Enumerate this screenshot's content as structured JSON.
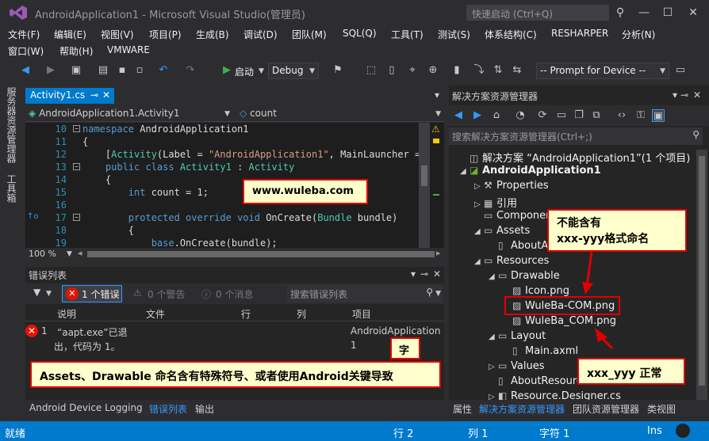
{
  "window": {
    "title": "AndroidApplication1 - Microsoft Visual Studio(管理员)",
    "quick_launch_placeholder": "快速启动 (Ctrl+Q)"
  },
  "menu": {
    "row1": [
      "文件(F)",
      "编辑(E)",
      "视图(V)",
      "项目(P)",
      "生成(B)",
      "调试(D)",
      "团队(M)",
      "SQL(Q)",
      "工具(T)",
      "测试(S)",
      "体系结构(C)",
      "RESHARPER",
      "分析(N)"
    ],
    "row2": [
      "窗口(W)",
      "帮助(H)",
      "VMWARE"
    ]
  },
  "toolbar": {
    "start_label": "启动",
    "config_value": "Debug",
    "device_value": "-- Prompt for Device --"
  },
  "left_strip": {
    "server_explorer": "服务器资源管理器",
    "toolbox": "工具箱"
  },
  "editor": {
    "tab_label": "Activity1.cs",
    "nav_left": "AndroidApplication1.Activity1",
    "nav_right": "count",
    "zoom": "100 %",
    "lines": [
      {
        "n": "10",
        "parts": [
          [
            "kw",
            "namespace"
          ],
          [
            "tx",
            " AndroidApplication1"
          ]
        ]
      },
      {
        "n": "11",
        "parts": [
          [
            "tx",
            "{"
          ]
        ]
      },
      {
        "n": "12",
        "parts": [
          [
            "tx",
            "    ["
          ],
          [
            "ty",
            "Activity"
          ],
          [
            "tx",
            "(Label = "
          ],
          [
            "st",
            "\"AndroidApplication1\""
          ],
          [
            "tx",
            ", MainLauncher ="
          ]
        ]
      },
      {
        "n": "13",
        "parts": [
          [
            "kw",
            "    public class "
          ],
          [
            "ty",
            "Activity1"
          ],
          [
            "tx",
            " : "
          ],
          [
            "ty",
            "Activity"
          ]
        ]
      },
      {
        "n": "14",
        "parts": [
          [
            "tx",
            "    {"
          ]
        ]
      },
      {
        "n": "15",
        "parts": [
          [
            "kw",
            "        int"
          ],
          [
            "tx",
            " count = 1;"
          ]
        ]
      },
      {
        "n": "16",
        "parts": [
          [
            "tx",
            ""
          ]
        ]
      },
      {
        "n": "17",
        "parts": [
          [
            "kw",
            "        protected override void"
          ],
          [
            "tx",
            " OnCreate("
          ],
          [
            "ty",
            "Bundle"
          ],
          [
            "tx",
            " bundle)"
          ]
        ]
      },
      {
        "n": "18",
        "parts": [
          [
            "tx",
            "        {"
          ]
        ]
      },
      {
        "n": "19",
        "parts": [
          [
            "kw",
            "            base"
          ],
          [
            "tx",
            ".OnCreate(bundle);"
          ]
        ]
      }
    ]
  },
  "error_list": {
    "title": "错误列表",
    "errors_btn": "1 个错误",
    "warnings_btn": "0 个警告",
    "messages_btn": "0 个消息",
    "search_placeholder": "搜索错误列表",
    "columns": [
      "说明",
      "文件",
      "行",
      "列",
      "项目"
    ],
    "rows": [
      {
        "num": "1",
        "desc_line1": "“aapt.exe”已退",
        "desc_line2": "出，代码为 1。",
        "project_line1": "AndroidApplication",
        "project_line2": "1"
      }
    ]
  },
  "bottom_tabs": [
    "Android Device Logging",
    "错误列表",
    "输出"
  ],
  "solution_explorer": {
    "title": "解决方案资源管理器",
    "search_placeholder": "搜索解决方案资源管理器(Ctrl+;)",
    "tree": [
      {
        "label": "解决方案 “AndroidApplication1”(1 个项目)",
        "arrow": "",
        "icon": "solution-icon",
        "level": 0
      },
      {
        "label": "AndroidApplication1",
        "arrow": "◢",
        "icon": "csharp-project-icon",
        "level": 0,
        "bold": true
      },
      {
        "label": "Properties",
        "arrow": "▷",
        "icon": "wrench-icon",
        "level": 1
      },
      {
        "label": "引用",
        "arrow": "▷",
        "icon": "references-icon",
        "level": 1
      },
      {
        "label": "Components",
        "arrow": "",
        "icon": "folder-icon",
        "level": 1
      },
      {
        "label": "Assets",
        "arrow": "◢",
        "icon": "folder-icon",
        "level": 1
      },
      {
        "label": "AboutAssets.txt",
        "arrow": "",
        "icon": "file-icon",
        "level": 2
      },
      {
        "label": "Resources",
        "arrow": "◢",
        "icon": "folder-icon",
        "level": 1
      },
      {
        "label": "Drawable",
        "arrow": "◢",
        "icon": "folder-icon",
        "level": 2
      },
      {
        "label": "Icon.png",
        "arrow": "",
        "icon": "image-icon",
        "level": 3
      },
      {
        "label": "WuleBa-COM.png",
        "arrow": "",
        "icon": "image-icon",
        "level": 3
      },
      {
        "label": "WuleBa_COM.png",
        "arrow": "",
        "icon": "image-icon",
        "level": 3
      },
      {
        "label": "Layout",
        "arrow": "◢",
        "icon": "folder-icon",
        "level": 2
      },
      {
        "label": "Main.axml",
        "arrow": "",
        "icon": "file-icon",
        "level": 3
      },
      {
        "label": "Values",
        "arrow": "▷",
        "icon": "folder-icon",
        "level": 2
      },
      {
        "label": "AboutResources.txt",
        "arrow": "",
        "icon": "file-icon",
        "level": 2
      },
      {
        "label": "Resource.Designer.cs",
        "arrow": "▷",
        "icon": "csharp-file-icon",
        "level": 2
      }
    ],
    "bottom_tabs": [
      "属性",
      "解决方案资源管理器",
      "团队资源管理器",
      "类视图"
    ]
  },
  "statusbar": {
    "ready": "就绪",
    "line": "行 2",
    "col": "列 1",
    "char": "字符 1",
    "mode": "Ins"
  },
  "annotations": {
    "watermark": "www.wuleba.com",
    "callout_invalid_line1": "不能含有",
    "callout_invalid_line2": "xxx-yyy格式命名",
    "callout_valid": "xxx_yyy 正常",
    "callout_char": "字",
    "callout_bottom": "Assets、Drawable 命名含有特殊符号、或者使用Android关键导致"
  },
  "colors": {
    "accent": "#007acc",
    "callout_border": "#e00000",
    "callout_bg": "#ffffcc"
  }
}
